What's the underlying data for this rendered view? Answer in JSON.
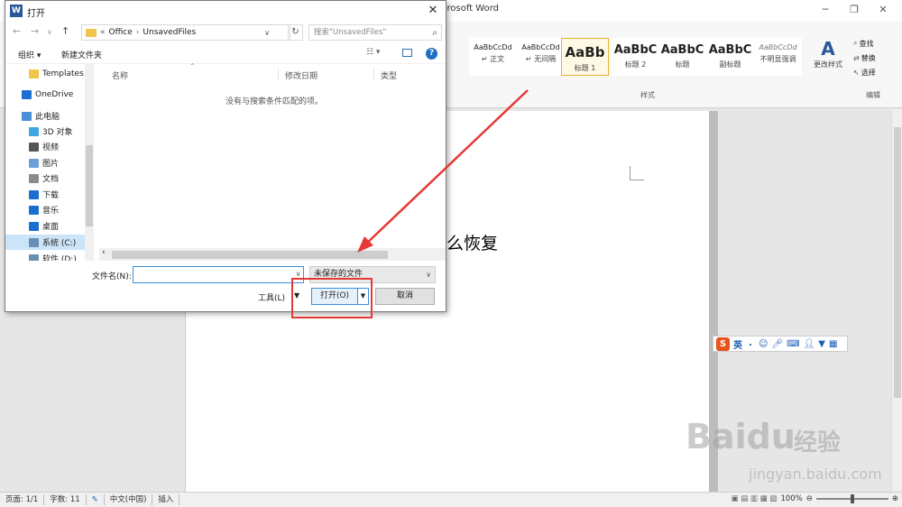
{
  "word": {
    "title": "crosoft Word",
    "styles": [
      {
        "sample": "AaBbCcDd",
        "name": "↵ 正文",
        "size": 8
      },
      {
        "sample": "AaBbCcDd",
        "name": "↵ 无间隔",
        "size": 8
      },
      {
        "sample": "AaBb",
        "name": "标题 1",
        "size": 15
      },
      {
        "sample": "AaBbC",
        "name": "标题 2",
        "size": 13
      },
      {
        "sample": "AaBbC",
        "name": "标题",
        "size": 13
      },
      {
        "sample": "AaBbC",
        "name": "副标题",
        "size": 13
      },
      {
        "sample": "AaBbCcDd",
        "name": "不明显强调",
        "size": 8
      }
    ],
    "styles_label": "样式",
    "change_styles_label": "更改样式",
    "edit_items": [
      "查找",
      "替换",
      "选择"
    ],
    "edit_label": "编辑",
    "doc_text": "么恢复",
    "status": {
      "page": "页面: 1/1",
      "words": "字数: 11",
      "language": "中文(中国)",
      "mode": "插入",
      "zoom": "100%"
    },
    "ime_label": "英"
  },
  "dialog": {
    "title": "打开",
    "address": {
      "prefix": "«",
      "crumbs": [
        "Office",
        "UnsavedFiles"
      ]
    },
    "search_placeholder": "搜索\"UnsavedFiles\"",
    "toolbar": {
      "organize": "组织 ▾",
      "new_folder": "新建文件夹"
    },
    "nav_items": [
      {
        "label": "Templates",
        "icon": "folder-icon",
        "color": "#f0c54a"
      },
      {
        "label": "OneDrive",
        "icon": "cloud-icon",
        "color": "#1c6fd1"
      },
      {
        "label": "此电脑",
        "icon": "computer-icon",
        "color": "#4a90d9"
      },
      {
        "label": "3D 对象",
        "icon": "cube-icon",
        "color": "#3fa7e0"
      },
      {
        "label": "视频",
        "icon": "video-icon",
        "color": "#555555"
      },
      {
        "label": "图片",
        "icon": "picture-icon",
        "color": "#6aa0d8"
      },
      {
        "label": "文档",
        "icon": "document-icon",
        "color": "#8a8a8a"
      },
      {
        "label": "下载",
        "icon": "download-icon",
        "color": "#1c6fd1"
      },
      {
        "label": "音乐",
        "icon": "music-icon",
        "color": "#1c6fd1"
      },
      {
        "label": "桌面",
        "icon": "desktop-icon",
        "color": "#1c6fd1"
      },
      {
        "label": "系统 (C:)",
        "icon": "drive-icon",
        "color": "#6a8fb5"
      },
      {
        "label": "软件 (D:)",
        "icon": "drive-icon",
        "color": "#6a8fb5"
      }
    ],
    "columns": [
      "名称",
      "修改日期",
      "类型"
    ],
    "empty_message": "没有与搜索条件匹配的项。",
    "filename_label": "文件名(N):",
    "filename_value": "",
    "filetype_value": "未保存的文件",
    "tools_label": "工具(L)",
    "open_label": "打开(O)",
    "cancel_label": "取消"
  },
  "watermark": {
    "brand": "Baidu",
    "text": "经验",
    "url": "jingyan.baidu.com"
  },
  "colors": {
    "annotation": "#e53935",
    "accent": "#3b8edb",
    "selected_style": "#e6b33a"
  }
}
